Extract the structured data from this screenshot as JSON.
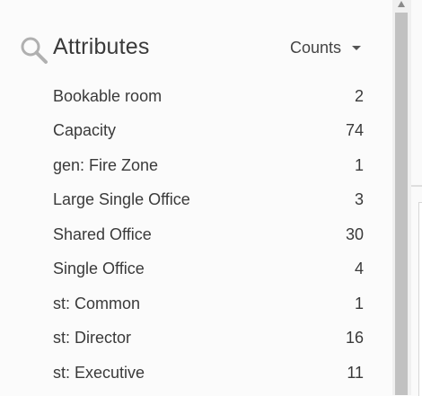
{
  "header": {
    "title": "Attributes",
    "counts_label": "Counts",
    "search_icon": "search-icon",
    "dropdown_icon": "caret-down-icon"
  },
  "attributes": [
    {
      "name": "Bookable room",
      "count": "2"
    },
    {
      "name": "Capacity",
      "count": "74"
    },
    {
      "name": "gen: Fire Zone",
      "count": "1"
    },
    {
      "name": "Large Single Office",
      "count": "3"
    },
    {
      "name": "Shared Office",
      "count": "30"
    },
    {
      "name": "Single Office",
      "count": "4"
    },
    {
      "name": "st: Common",
      "count": "1"
    },
    {
      "name": "st: Director",
      "count": "16"
    },
    {
      "name": "st: Executive",
      "count": "11"
    }
  ],
  "colors": {
    "text": "#3a3a3a",
    "background": "#fbfbfb",
    "icon": "#b0b0b0",
    "scrollbar_thumb": "#c1c1c1"
  }
}
